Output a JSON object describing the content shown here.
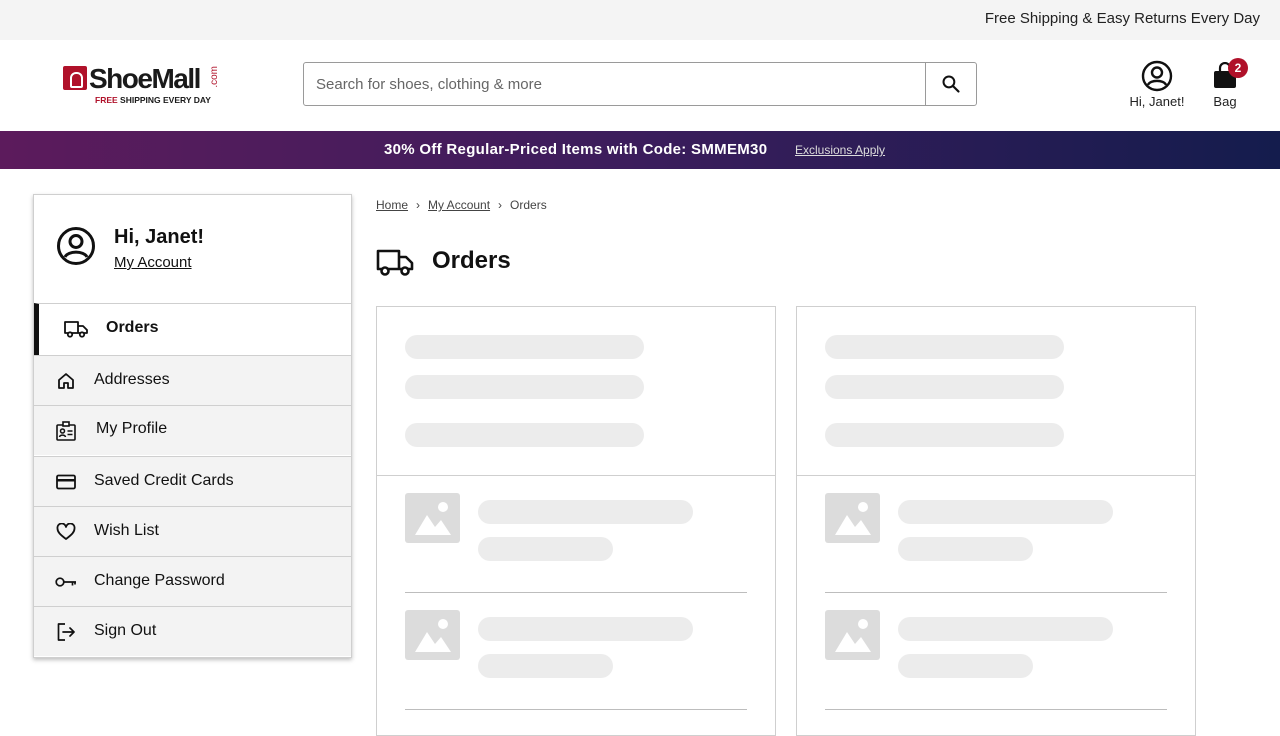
{
  "topbar": {
    "message": "Free Shipping & Easy Returns Every Day"
  },
  "logo": {
    "brand": "ShoeMall",
    "dotcom": ".com",
    "tag_highlight": "FREE",
    "tag_rest": " SHIPPING EVERY DAY"
  },
  "search": {
    "placeholder": "Search for shoes, clothing & more",
    "value": ""
  },
  "header": {
    "account_label": "Hi, Janet!",
    "bag_label": "Bag",
    "bag_count": "2"
  },
  "promo": {
    "text": "30% Off Regular-Priced Items with Code: SMMEM30",
    "link": "Exclusions Apply"
  },
  "sidebar": {
    "greeting": "Hi, Janet!",
    "account_link": "My Account",
    "items": [
      {
        "label": "Orders",
        "icon": "truck-icon"
      },
      {
        "label": "Addresses",
        "icon": "home-icon"
      },
      {
        "label": "My Profile",
        "icon": "profile-card-icon"
      },
      {
        "label": "Saved Credit Cards",
        "icon": "credit-card-icon"
      },
      {
        "label": "Wish List",
        "icon": "heart-icon"
      },
      {
        "label": "Change Password",
        "icon": "key-icon"
      },
      {
        "label": "Sign Out",
        "icon": "sign-out-icon"
      }
    ]
  },
  "breadcrumb": {
    "home": "Home",
    "account": "My Account",
    "current": "Orders"
  },
  "page": {
    "title": "Orders",
    "title_icon": "truck-icon"
  },
  "colors": {
    "brand_red": "#b0112a",
    "promo_start": "#5c1b5c",
    "promo_end": "#141c4d",
    "skeleton": "#ececec"
  }
}
